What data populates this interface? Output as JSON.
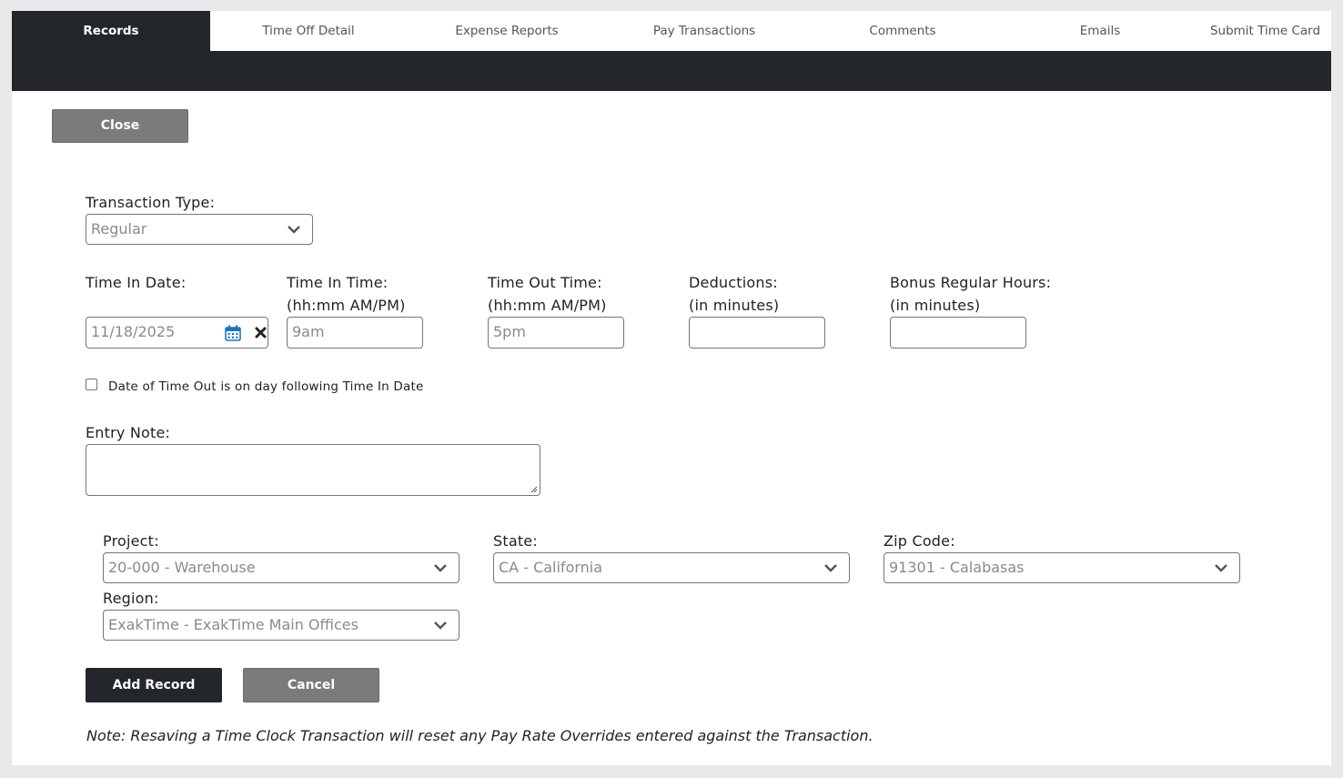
{
  "tabs": [
    {
      "label": "Records",
      "active": true
    },
    {
      "label": "Time Off Detail"
    },
    {
      "label": "Expense Reports"
    },
    {
      "label": "Pay Transactions"
    },
    {
      "label": "Comments"
    },
    {
      "label": "Emails"
    },
    {
      "label": "Submit Time Card"
    }
  ],
  "close_label": "Close",
  "form": {
    "transaction_type_label": "Transaction Type:",
    "transaction_type_value": "Regular",
    "time_in_date_label": "Time In Date:",
    "time_in_date_value": "11/18/2025",
    "time_in_time_label": "Time In Time:",
    "time_in_time_hint": "(hh:mm AM/PM)",
    "time_in_time_value": "9am",
    "time_out_time_label": "Time Out Time:",
    "time_out_time_hint": "(hh:mm AM/PM)",
    "time_out_time_value": "5pm",
    "deductions_label": "Deductions:",
    "deductions_hint": "(in minutes)",
    "deductions_value": "",
    "bonus_label": "Bonus Regular Hours:",
    "bonus_hint": "(in minutes)",
    "bonus_value": "",
    "next_day_checkbox_label": "Date of Time Out is on day following Time In Date",
    "next_day_checked": false,
    "entry_note_label": "Entry Note:",
    "entry_note_value": "",
    "project_label": "Project:",
    "project_value": "20-000 - Warehouse",
    "state_label": "State:",
    "state_value": "CA - California",
    "zip_label": "Zip Code:",
    "zip_value": "91301 - Calabasas",
    "region_label": "Region:",
    "region_value": "ExakTime - ExakTime Main Offices"
  },
  "actions": {
    "add_label": "Add Record",
    "cancel_label": "Cancel"
  },
  "note_text": "Note: Resaving a Time Clock Transaction will reset any Pay Rate Overrides entered against the Transaction.",
  "icons": {
    "calendar": "calendar-icon",
    "clear": "clear-date-icon",
    "chevron": "chevron-down-icon"
  },
  "colors": {
    "dark": "#23272b",
    "gray_button": "#7b7b7b",
    "calendar_blue": "#1a73c9"
  }
}
